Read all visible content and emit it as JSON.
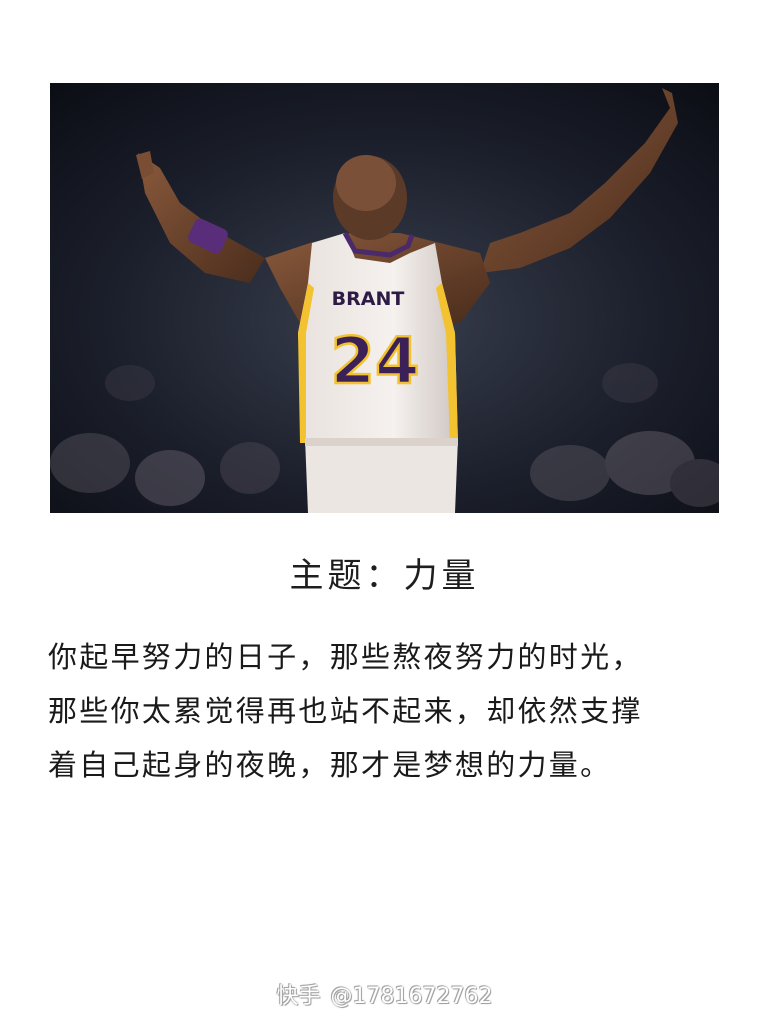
{
  "photo": {
    "jersey_name": "BRANT",
    "jersey_number": "24"
  },
  "theme": {
    "title": "主题：力量"
  },
  "quote": {
    "lines": [
      "你起早努力的日子，那些熬夜努力的时光，",
      "那些你太累觉得再也站不起来，却依然支撑",
      "着自己起身的夜晚，那才是梦想的力量。"
    ]
  },
  "watermark": {
    "app": "快手",
    "handle": "@1781672762"
  }
}
